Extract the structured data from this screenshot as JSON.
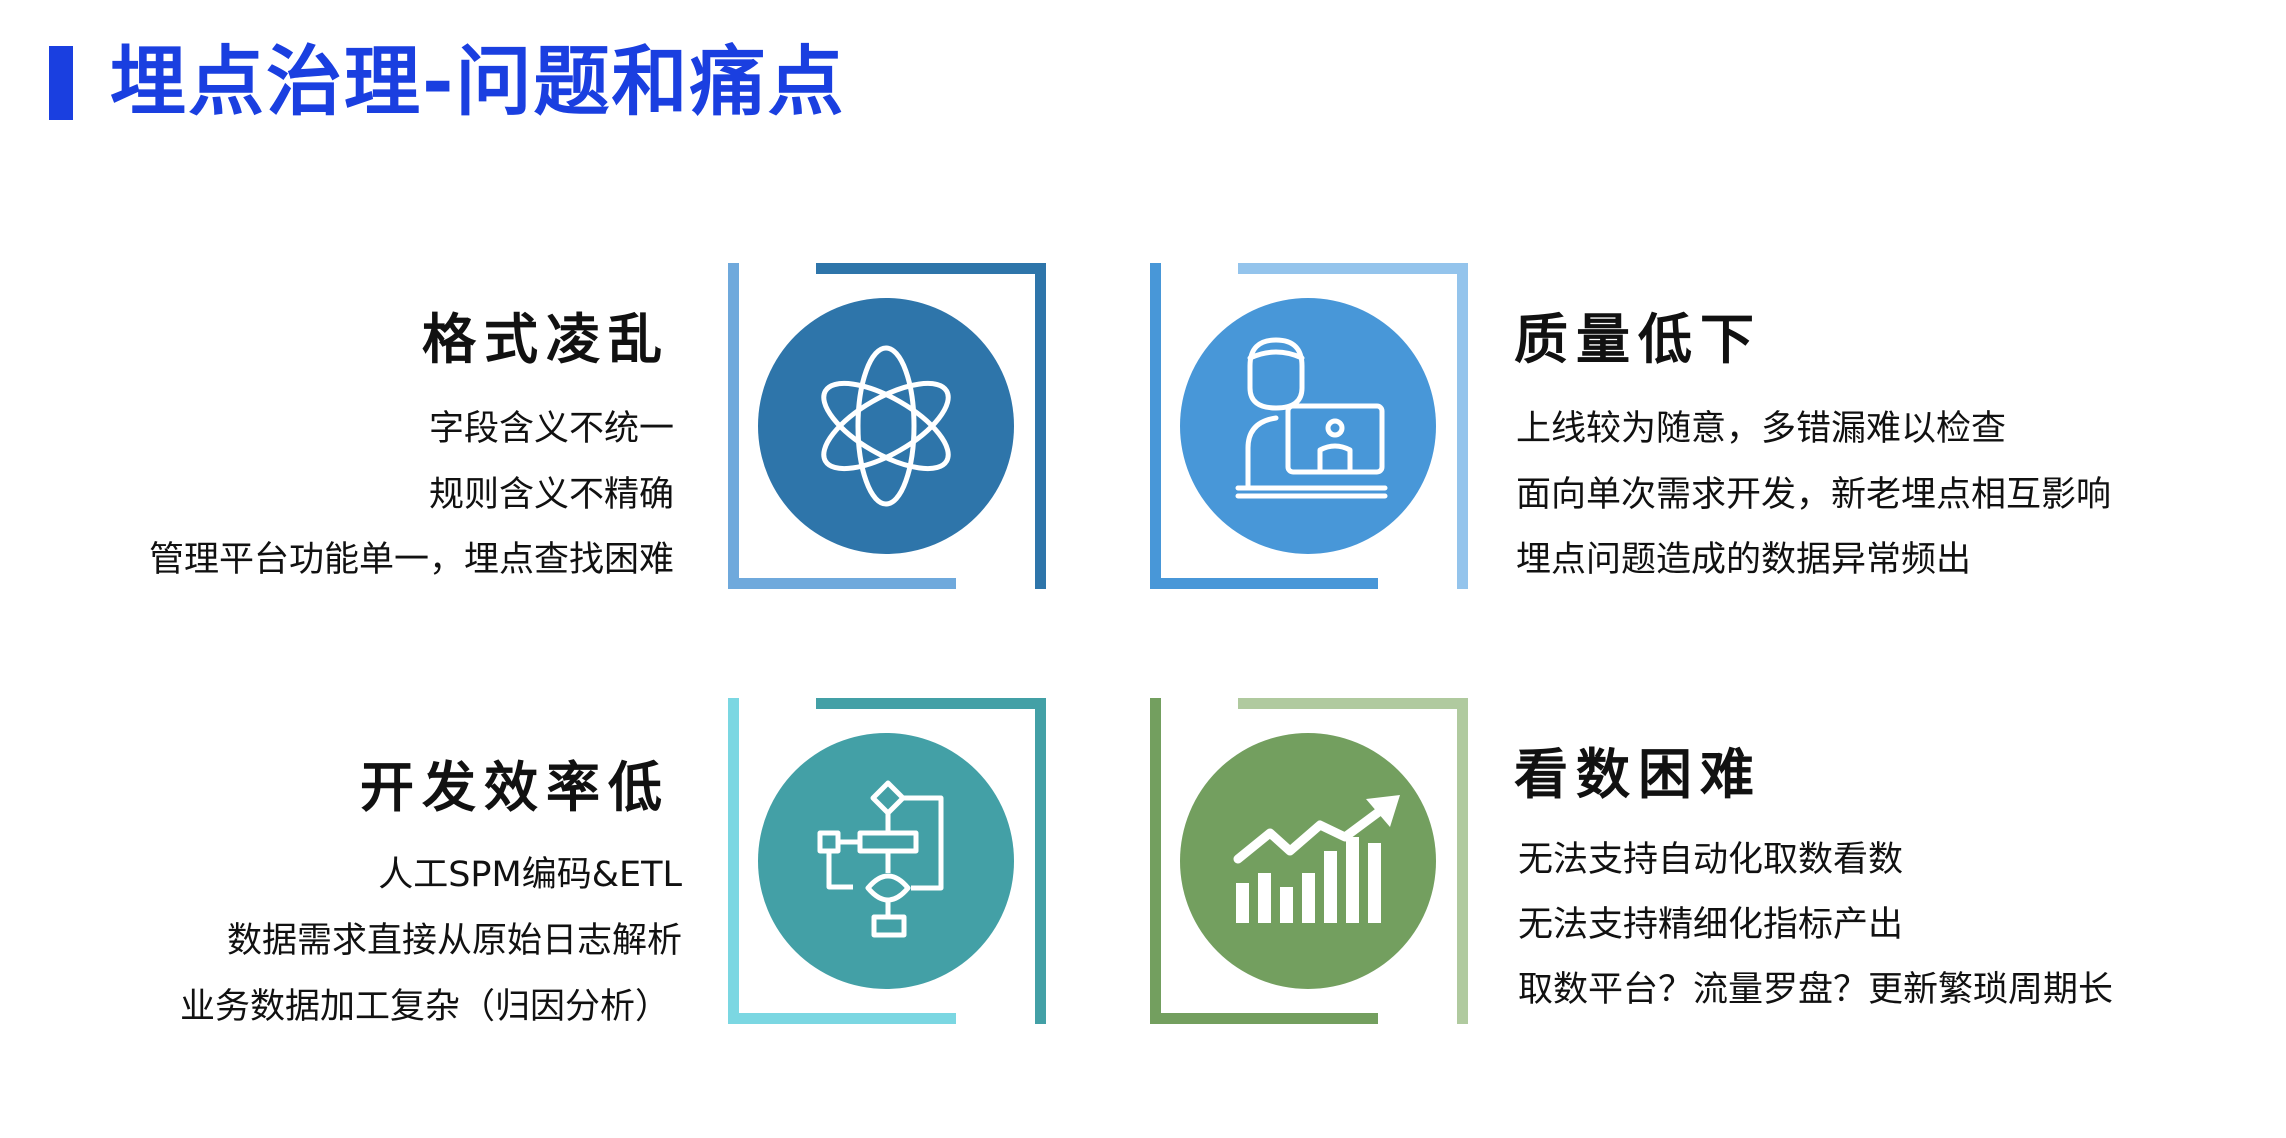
{
  "title": "埋点治理-问题和痛点",
  "colors": {
    "title": "#1a3fe0",
    "card1": "#2e75aa",
    "card2": "#4897d8",
    "card3": "#43a0a6",
    "card4": "#739f5f"
  },
  "cards": [
    {
      "heading": "格式凌乱",
      "lines": [
        "字段含义不统一",
        "规则含义不精确",
        "管理平台功能单一，埋点查找困难"
      ],
      "icon": "atom-icon"
    },
    {
      "heading": "质量低下",
      "lines": [
        "上线较为随意，多错漏难以检查",
        "面向单次需求开发，新老埋点相互影响",
        "埋点问题造成的数据异常频出"
      ],
      "icon": "developer-computer-icon"
    },
    {
      "heading": "开发效率低",
      "lines": [
        "人工SPM编码&ETL",
        "数据需求直接从原始日志解析",
        "业务数据加工复杂（归因分析）"
      ],
      "icon": "flowchart-icon"
    },
    {
      "heading": "看数困难",
      "lines": [
        "无法支持自动化取数看数",
        "无法支持精细化指标产出",
        "取数平台？流量罗盘？更新繁琐周期长"
      ],
      "icon": "growth-chart-icon"
    }
  ]
}
